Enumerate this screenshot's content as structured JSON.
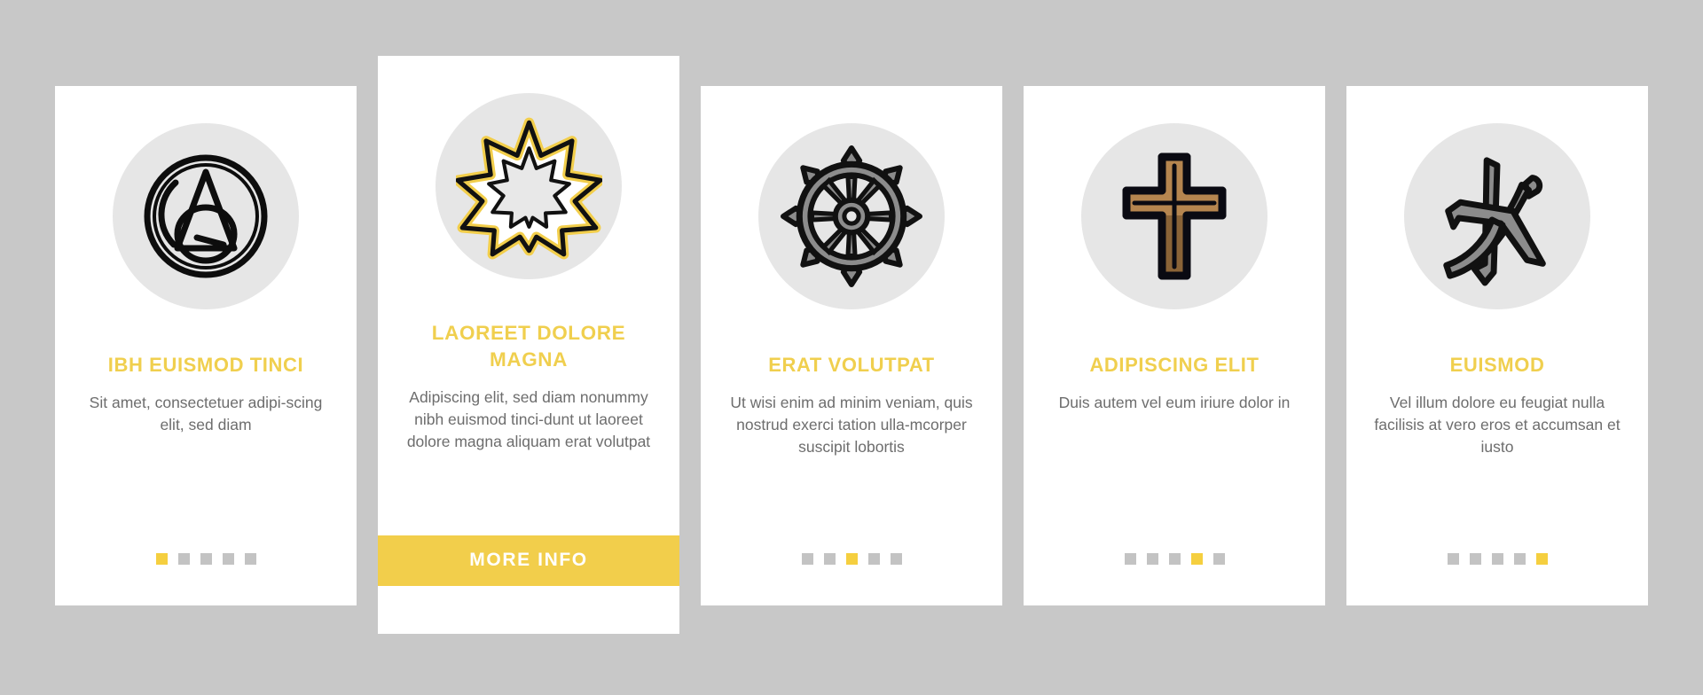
{
  "page": {
    "background_color": "#c8c8c8",
    "accent_color": "#f2ce4b",
    "title_color": "#f0cf4e",
    "body_text_color": "#6d6d6d",
    "card_background": "#ffffff",
    "icon_circle_color": "#e6e6e6",
    "dot_inactive_color": "#c3c3c3",
    "dot_active_color": "#f5cf3f"
  },
  "cards": [
    {
      "icon_name": "atheism-symbol-icon",
      "title": "IBH EUISMOD TINCI",
      "description": "Sit amet, consectetuer adipi-scing elit, sed diam",
      "dots_total": 5,
      "dots_active_index": 0,
      "featured": false
    },
    {
      "icon_name": "bahai-nine-pointed-star-icon",
      "title": "LAOREET DOLORE MAGNA",
      "description": "Adipiscing elit, sed diam nonummy nibh euismod tinci-dunt ut laoreet dolore magna aliquam erat volutpat",
      "button_label": "MORE INFO",
      "featured": true
    },
    {
      "icon_name": "dharma-wheel-icon",
      "title": "ERAT VOLUTPAT",
      "description": "Ut wisi enim ad minim veniam, quis nostrud exerci tation ulla-mcorper suscipit lobortis",
      "dots_total": 5,
      "dots_active_index": 2,
      "featured": false
    },
    {
      "icon_name": "christian-cross-icon",
      "title": "ADIPISCING ELIT",
      "description": "Duis autem vel eum iriure dolor in",
      "dots_total": 5,
      "dots_active_index": 3,
      "featured": false
    },
    {
      "icon_name": "confucianism-symbol-icon",
      "title": "EUISMOD",
      "description": "Vel illum dolore eu feugiat nulla facilisis at vero eros et accumsan et iusto",
      "dots_total": 5,
      "dots_active_index": 4,
      "featured": false
    }
  ]
}
